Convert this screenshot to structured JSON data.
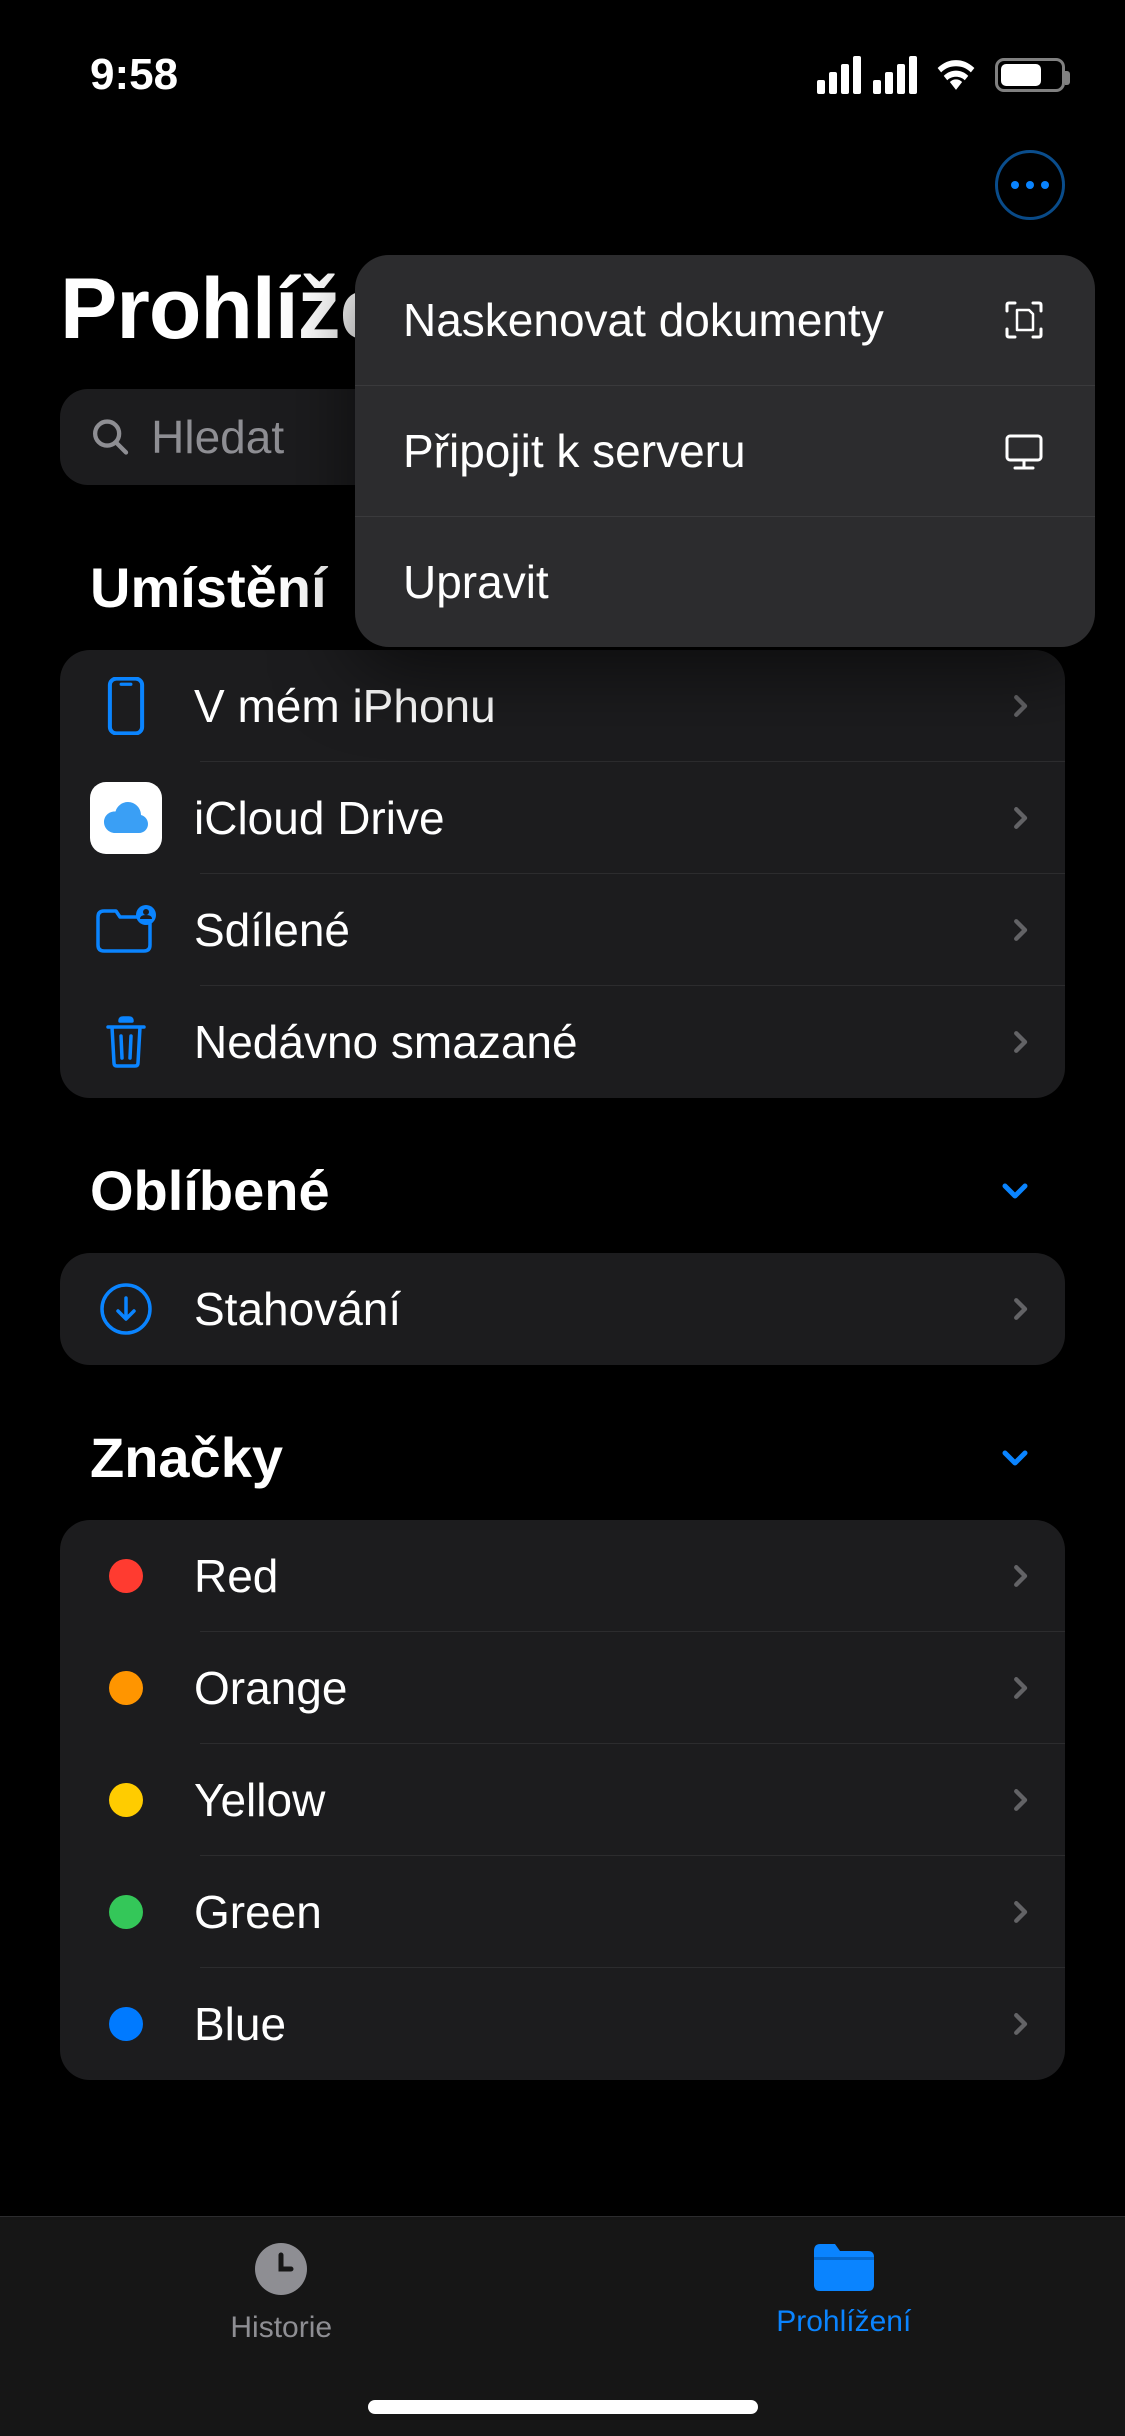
{
  "status": {
    "time": "9:58"
  },
  "page_title": "Prohlížení",
  "search": {
    "placeholder": "Hledat"
  },
  "popup": {
    "items": [
      {
        "label": "Naskenovat dokumenty",
        "icon": "scan-icon"
      },
      {
        "label": "Připojit k serveru",
        "icon": "server-icon"
      },
      {
        "label": "Upravit",
        "icon": ""
      }
    ]
  },
  "sections": {
    "locations": {
      "title": "Umístění",
      "items": [
        {
          "label": "V mém iPhonu",
          "icon": "iphone-icon",
          "color": "#0a84ff"
        },
        {
          "label": "iCloud Drive",
          "icon": "icloud-icon",
          "color": "#3a9ff5"
        },
        {
          "label": "Sdílené",
          "icon": "shared-folder-icon",
          "color": "#0a84ff"
        },
        {
          "label": "Nedávno smazané",
          "icon": "trash-icon",
          "color": "#0a84ff"
        }
      ]
    },
    "favorites": {
      "title": "Oblíbené",
      "items": [
        {
          "label": "Stahování",
          "icon": "download-icon",
          "color": "#0a84ff"
        }
      ]
    },
    "tags": {
      "title": "Značky",
      "items": [
        {
          "label": "Red",
          "color": "#ff3b30"
        },
        {
          "label": "Orange",
          "color": "#ff9500"
        },
        {
          "label": "Yellow",
          "color": "#ffcc00"
        },
        {
          "label": "Green",
          "color": "#34c759"
        },
        {
          "label": "Blue",
          "color": "#007aff"
        }
      ]
    }
  },
  "tabs": {
    "history": "Historie",
    "browse": "Prohlížení"
  }
}
